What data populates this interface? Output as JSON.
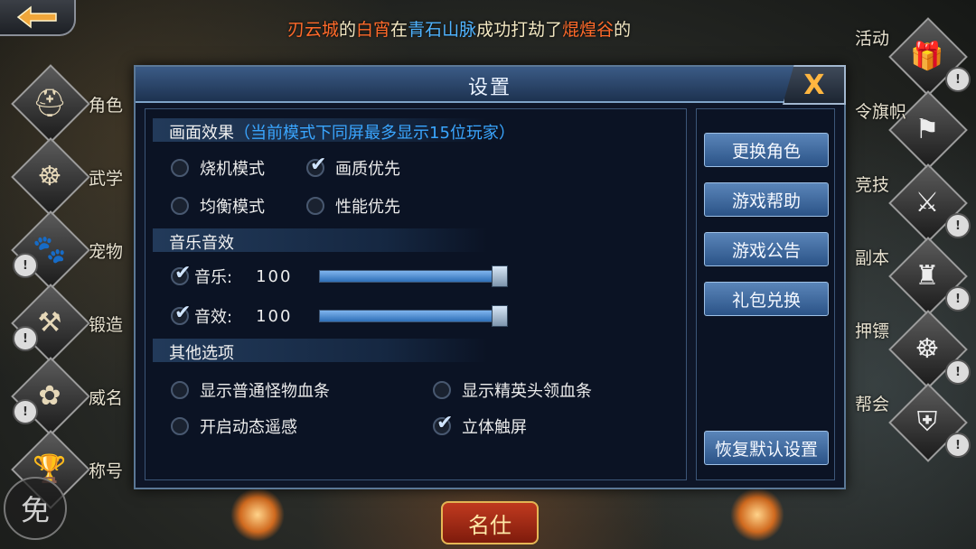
{
  "broadcast": {
    "part1": "刃云城",
    "part2": "的",
    "part3": "白宵",
    "part4": "在",
    "part5": "青石山脉",
    "part6": "成功打劫了",
    "part7": "焜煌谷",
    "part8": "的"
  },
  "left_menu": [
    {
      "label": "角色",
      "icon": "helmet-icon",
      "glyph": "⛑",
      "locked": false
    },
    {
      "label": "武学",
      "icon": "meditation-icon",
      "glyph": "☸",
      "locked": false
    },
    {
      "label": "宠物",
      "icon": "paw-icon",
      "glyph": "🐾",
      "locked": true
    },
    {
      "label": "锻造",
      "icon": "hammer-icon",
      "glyph": "⚒",
      "locked": true
    },
    {
      "label": "威名",
      "icon": "lotus-icon",
      "glyph": "✿",
      "locked": true
    },
    {
      "label": "称号",
      "icon": "trophy-icon",
      "glyph": "🏆",
      "locked": false
    }
  ],
  "right_menu": [
    {
      "label": "活动",
      "icon": "gift-icon",
      "glyph": "🎁"
    },
    {
      "label": "令旗帜",
      "icon": "banner-icon",
      "glyph": "⚑"
    },
    {
      "label": "竞技",
      "icon": "crossed-swords-icon",
      "glyph": "⚔"
    },
    {
      "label": "副本",
      "icon": "tower-icon",
      "glyph": "♜"
    },
    {
      "label": "押镖",
      "icon": "wheel-icon",
      "glyph": "☸"
    },
    {
      "label": "帮会",
      "icon": "shield-icon",
      "glyph": "⛨"
    }
  ],
  "free_badge": "免",
  "bottom_title": "名仕",
  "modal": {
    "title": "设置",
    "close_label": "X",
    "graphics": {
      "title": "画面效果",
      "note": "（当前模式下同屏最多显示15位玩家）",
      "options": [
        {
          "label": "烧机模式",
          "checked": false
        },
        {
          "label": "画质优先",
          "checked": true
        },
        {
          "label": "均衡模式",
          "checked": false
        },
        {
          "label": "性能优先",
          "checked": false
        }
      ]
    },
    "audio": {
      "title": "音乐音效",
      "music_label": "音乐:",
      "music_value": "100",
      "music_level": 1.0,
      "sfx_label": "音效:",
      "sfx_value": "100",
      "sfx_level": 1.0
    },
    "other": {
      "title": "其他选项",
      "options": [
        {
          "label": "显示普通怪物血条",
          "checked": false
        },
        {
          "label": "显示精英头领血条",
          "checked": false
        },
        {
          "label": "开启动态遥感",
          "checked": false
        },
        {
          "label": "立体触屏",
          "checked": true
        }
      ]
    },
    "buttons": {
      "change_role": "更换角色",
      "help": "游戏帮助",
      "notice": "游戏公告",
      "gift_code": "礼包兑换",
      "reset": "恢复默认设置"
    }
  },
  "colors": {
    "accent": "#3aa6ff",
    "broadcast_name": "#ff6a2a",
    "broadcast_place": "#4fb3ff"
  }
}
